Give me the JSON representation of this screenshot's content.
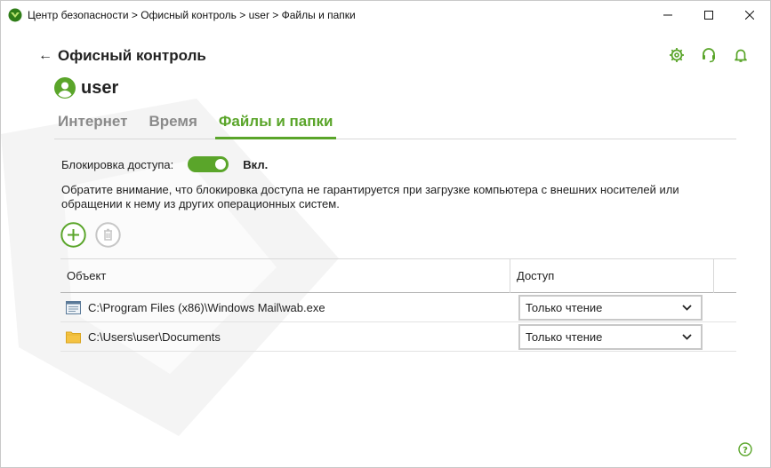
{
  "window": {
    "breadcrumb": "Центр безопасности > Офисный контроль > user > Файлы и папки"
  },
  "header": {
    "back_label": "Офисный контроль",
    "user_name": "user"
  },
  "tabs": [
    {
      "label": "Интернет",
      "active": false
    },
    {
      "label": "Время",
      "active": false
    },
    {
      "label": "Файлы и папки",
      "active": true
    }
  ],
  "access_lock": {
    "label": "Блокировка доступа:",
    "state_label": "Вкл.",
    "enabled": true
  },
  "notice": "Обратите внимание, что блокировка доступа не гарантируется при загрузке компьютера с внешних носителей или обращении к нему из других операционных систем.",
  "table": {
    "columns": [
      "Объект",
      "Доступ"
    ],
    "rows": [
      {
        "icon": "application-icon",
        "object": "C:\\Program Files (x86)\\Windows Mail\\wab.exe",
        "access": "Только чтение"
      },
      {
        "icon": "folder-icon",
        "object": "C:\\Users\\user\\Documents",
        "access": "Только чтение"
      }
    ]
  },
  "colors": {
    "accent": "#5aa52a",
    "tab_inactive": "#8a8a8a",
    "folder": "#f5c342"
  }
}
